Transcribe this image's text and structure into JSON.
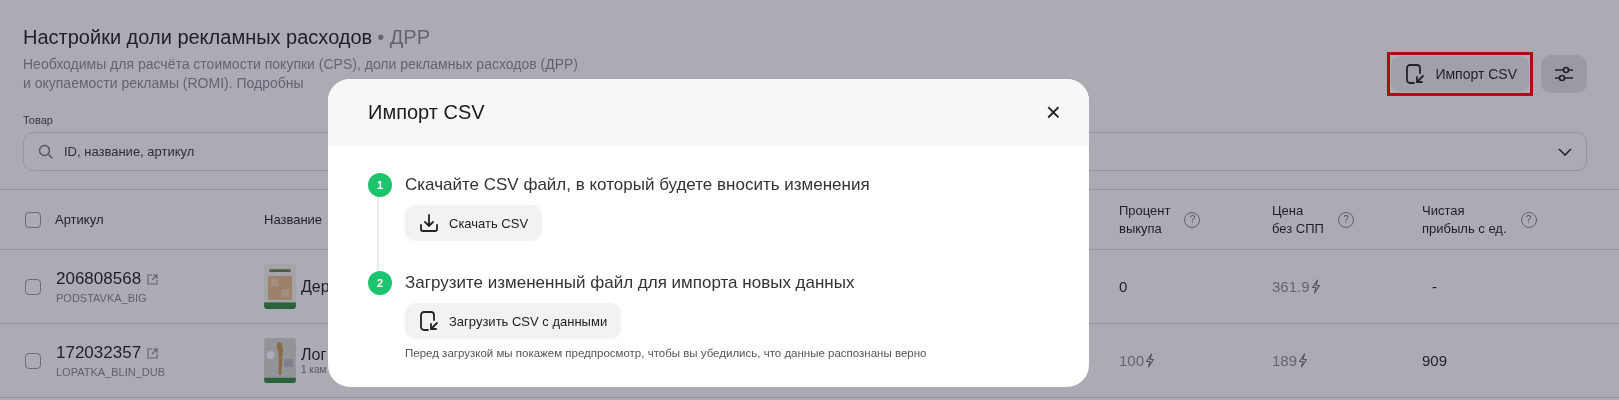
{
  "header": {
    "title": "Настройки доли рекламных расходов",
    "title_suffix": "• ДРР",
    "description": [
      "Необходимы для расчёта стоимости покупки (CPS), доли рекламных расходов (ДРР)",
      "и окупаемости рекламы (ROMI). Подробны"
    ]
  },
  "toolbar": {
    "import_button": "Импорт CSV",
    "highlighted": true
  },
  "filter": {
    "label": "Товар",
    "placeholder": "ID, название, артикул"
  },
  "table": {
    "select_all_checked": false,
    "columns": [
      {
        "label": "Артикул"
      },
      {
        "label": "Название"
      },
      {
        "label": "Процент\nвыкупа",
        "help": "?"
      },
      {
        "label": "Цена\nбез СПП",
        "help": "?"
      },
      {
        "label": "Чистая\nприбыль с ед.",
        "help": "?"
      }
    ],
    "rows": [
      {
        "checked": false,
        "sku": "206808568",
        "code": "PODSTAVKA_BIG",
        "name": "Дер",
        "buyout": {
          "value": "0",
          "auto": false
        },
        "price": {
          "value": "361.9",
          "auto": true
        },
        "profit": {
          "value": "-",
          "auto": false
        }
      },
      {
        "checked": false,
        "sku": "172032357",
        "code": "LOPATKA_BLIN_DUB",
        "name": "Лог",
        "subtitle": "1 кам",
        "buyout": {
          "value": "100",
          "auto": true
        },
        "price": {
          "value": "189",
          "auto": true
        },
        "profit": {
          "value": "909",
          "auto": false
        }
      }
    ]
  },
  "modal": {
    "title": "Импорт CSV",
    "close": "×",
    "steps": [
      {
        "number": "1",
        "title": "Скачайте CSV файл, в который будете вносить изменения",
        "button": "Скачать CSV",
        "kind": "download"
      },
      {
        "number": "2",
        "title": "Загрузите измененный файл для импорта новых данных",
        "button": "Загрузить CSV с данными",
        "kind": "upload"
      }
    ],
    "note": "Перед загрузкой мы покажем предпросмотр, чтобы вы убедились, что данные распознаны верно"
  }
}
